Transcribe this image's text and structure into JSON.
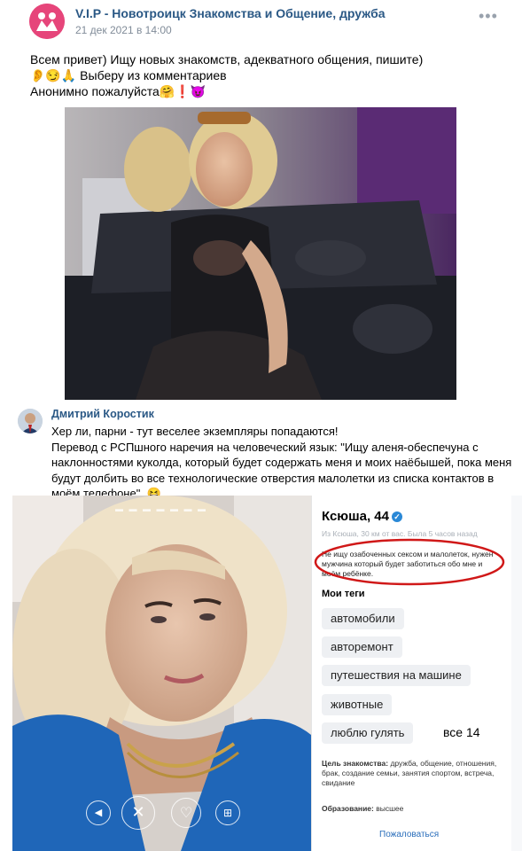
{
  "post": {
    "group_name": "V.I.P - Новотроицк Знакомства и Общение, дружба",
    "date": "21 дек 2021 в 14:00",
    "more": "•••",
    "text": "Всем привет) Ищу новых знакомств, адекватного общения, пишите)\n👂😏🙏 Выберу из комментариев\nАнонимно пожалуйста🤗❗😈"
  },
  "comment": {
    "author": "Дмитрий Коростик",
    "text": "Хер ли, парни - тут веселее экземпляры попадаются!\nПеревод с РСПшного наречия на человеческий язык: \"Ищу аленя-обеспечуна с наклонностями куколда, который будет содержать меня и моих наёбышей, пока меня будут долбить во все технологические отверстия малолетки из списка контактов в моём телефоне\". 😆"
  },
  "profile": {
    "name": "Ксюша, 44",
    "meta": "Из Ксюша, 30 км от вас. Была 5 часов назад",
    "about": "Не ищу озабоченных сексом и малолеток, нужен мужчина который будет заботиться обо мне и моём ребёнке.",
    "tags_title": "Мои теги",
    "tags": [
      "автомобили",
      "авторемонт",
      "путешествия на машине",
      "животные",
      "люблю гулять"
    ],
    "tags_more": "все 14",
    "goal_label": "Цель знакомства:",
    "goal_value": " дружба, общение, отношения, брак, создание семьи, занятия спортом, встреча, свидание",
    "edu_label": "Образование:",
    "edu_value": " высшее",
    "report": "Пожаловаться"
  },
  "icons": {
    "back": "back-icon",
    "dislike": "close-icon",
    "like": "heart-icon",
    "gift": "gift-icon"
  },
  "colors": {
    "link": "#2a5885",
    "group_avatar": "#e6457a",
    "annotation": "#d01818"
  }
}
